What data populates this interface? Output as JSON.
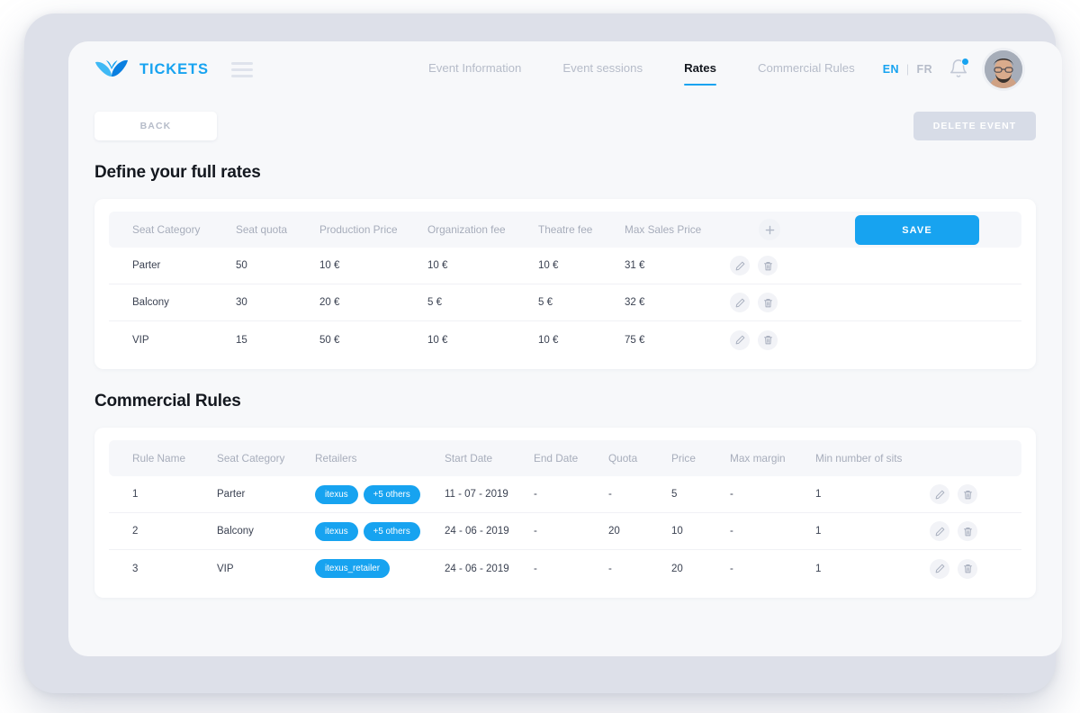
{
  "brand": {
    "name": "TICKETS",
    "logo_icon": "bird-logo-icon",
    "accent_color": "#17a3f0"
  },
  "nav": {
    "items": [
      {
        "label": "Event Information",
        "active": false
      },
      {
        "label": "Event sessions",
        "active": false
      },
      {
        "label": "Rates",
        "active": true
      },
      {
        "label": "Commercial Rules",
        "active": false
      }
    ]
  },
  "topbar_right": {
    "lang_active": "EN",
    "lang_separator": "|",
    "lang_inactive": "FR",
    "bell_icon": "notification-bell-icon",
    "has_notification": true,
    "avatar_icon": "user-avatar"
  },
  "actions": {
    "back_label": "BACK",
    "delete_label": "DELETE EVENT",
    "save_label": "SAVE",
    "add_icon": "plus-icon",
    "edit_icon": "pencil-icon",
    "delete_icon": "trash-icon"
  },
  "rates": {
    "title": "Define your full rates",
    "columns": [
      "Seat Category",
      "Seat quota",
      "Production Price",
      "Organization fee",
      "Theatre fee",
      "Max Sales Price"
    ],
    "rows": [
      {
        "seat_category": "Parter",
        "seat_quota": "50",
        "production_price": "10 €",
        "organization_fee": "10 €",
        "theatre_fee": "10 €",
        "max_sales_price": "31 €"
      },
      {
        "seat_category": "Balcony",
        "seat_quota": "30",
        "production_price": "20 €",
        "organization_fee": "5 €",
        "theatre_fee": "5 €",
        "max_sales_price": "32 €"
      },
      {
        "seat_category": "VIP",
        "seat_quota": "15",
        "production_price": "50 €",
        "organization_fee": "10 €",
        "theatre_fee": "10 €",
        "max_sales_price": "75 €"
      }
    ]
  },
  "commercial_rules": {
    "title": "Commercial Rules",
    "columns": [
      "Rule Name",
      "Seat Category",
      "Retailers",
      "Start Date",
      "End Date",
      "Quota",
      "Price",
      "Max margin",
      "Min number of sits"
    ],
    "rows": [
      {
        "rule_name": "1",
        "seat_category": "Parter",
        "retailers": [
          "itexus",
          "+5 others"
        ],
        "start_date": "11 - 07 - 2019",
        "end_date": "-",
        "quota": "-",
        "price": "5",
        "max_margin": "-",
        "min_sits": "1"
      },
      {
        "rule_name": "2",
        "seat_category": "Balcony",
        "retailers": [
          "itexus",
          "+5 others"
        ],
        "start_date": "24 - 06 - 2019",
        "end_date": "-",
        "quota": "20",
        "price": "10",
        "max_margin": "-",
        "min_sits": "1"
      },
      {
        "rule_name": "3",
        "seat_category": "VIP",
        "retailers": [
          "itexus_retailer"
        ],
        "start_date": "24 - 06 - 2019",
        "end_date": "-",
        "quota": "-",
        "price": "20",
        "max_margin": "-",
        "min_sits": "1"
      }
    ]
  }
}
